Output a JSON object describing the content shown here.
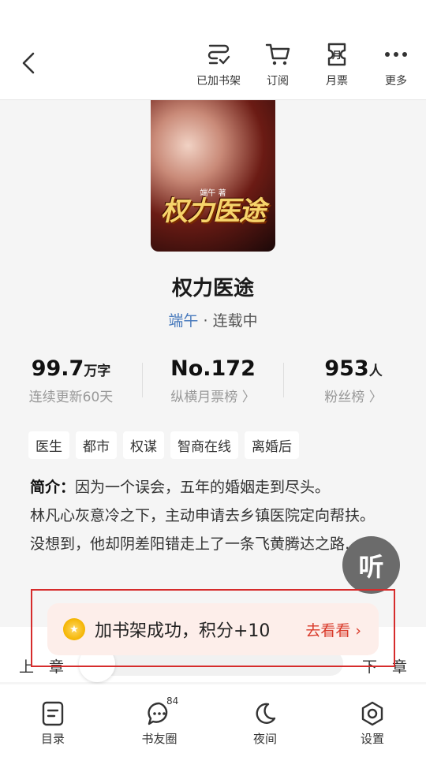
{
  "header": {
    "actions": [
      {
        "label": "已加书架",
        "icon": "bookshelf-check-icon"
      },
      {
        "label": "订阅",
        "icon": "cart-icon"
      },
      {
        "label": "月票",
        "icon": "ticket-icon"
      },
      {
        "label": "更多",
        "icon": "more-dots-icon"
      }
    ]
  },
  "cover": {
    "title": "权力医途",
    "author": "端午 著"
  },
  "book": {
    "title": "权力医途",
    "author": "端午",
    "status": "· 连载中"
  },
  "stats": [
    {
      "value": "99.7",
      "unit": "万字",
      "sub": "连续更新60天"
    },
    {
      "value": "No.172",
      "unit": "",
      "sub": "纵横月票榜 〉"
    },
    {
      "value": "953",
      "unit": "人",
      "sub": "粉丝榜 〉"
    }
  ],
  "tags": [
    "医生",
    "都市",
    "权谋",
    "智商在线",
    "离婚后"
  ],
  "intro": {
    "label": "简介：",
    "line1": "因为一个误会，五年的婚姻走到尽头。",
    "line2": "林凡心灰意冷之下，主动申请去乡镇医院定向帮扶。",
    "line3": "没想到，他却阴差阳错走上了一条飞黄腾达之路……"
  },
  "listen_button": "听",
  "chapter": {
    "prev": "上一章",
    "next": "下一章"
  },
  "toast": {
    "message": "加书架成功，积分+10",
    "action": "去看看 ›"
  },
  "bottom_nav": [
    {
      "label": "目录",
      "icon": "catalog-icon"
    },
    {
      "label": "书友圈",
      "icon": "chat-bubble-icon",
      "badge": "84"
    },
    {
      "label": "夜间",
      "icon": "moon-icon"
    },
    {
      "label": "设置",
      "icon": "settings-icon"
    }
  ],
  "colors": {
    "author_link": "#4a7bbd",
    "toast_action": "#d93a2a",
    "highlight_box": "#d62c2c"
  }
}
